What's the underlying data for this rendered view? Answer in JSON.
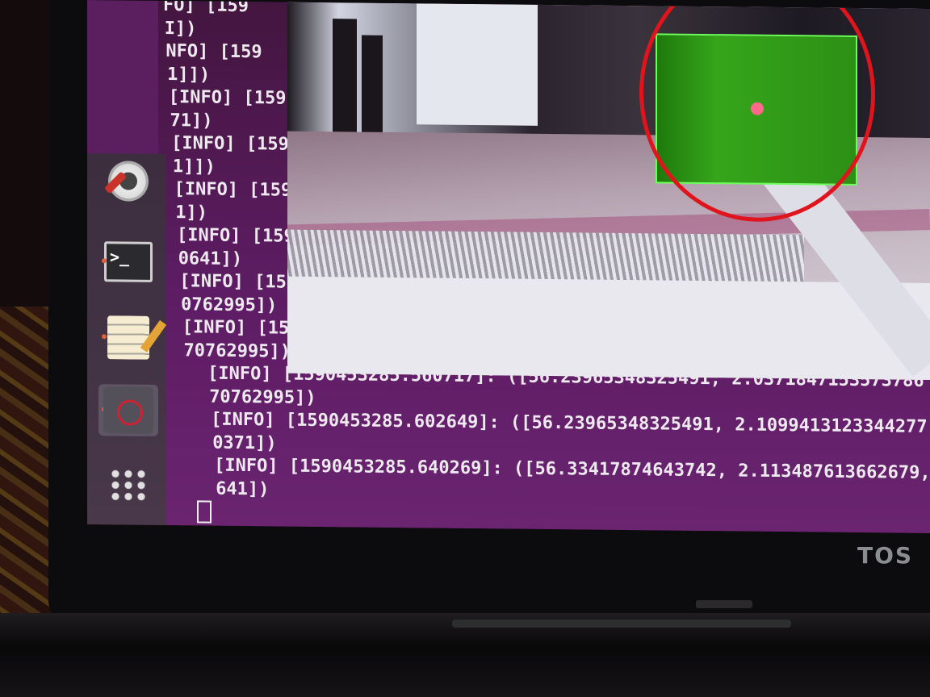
{
  "terminal": {
    "lines": [
      "FO] [159",
      "I])",
      "NFO] [159",
      "1]])",
      "[INFO] [159",
      "71])",
      "[INFO] [159",
      "1]])",
      "[INFO] [159",
      "1])",
      "[INFO] [159",
      "0641])",
      "[INFO] [159",
      "0762995])",
      "[INFO] [159",
      "70762995])",
      "[INFO] [1590453285.560717]: ([56.23965348325491, 2.0371847153573786",
      "70762995])",
      "[INFO] [1590453285.602649]: ([56.23965348325491, 2.1099413123344277,",
      "0371])",
      "[INFO] [1590453285.640269]: ([56.33417874643742, 2.113487613662679,",
      "641])"
    ]
  },
  "launcher": {
    "items": [
      {
        "name": "settings",
        "icon": "settings-gear-icon"
      },
      {
        "name": "terminal",
        "icon": "terminal-icon",
        "glyph": ">_"
      },
      {
        "name": "text-editor",
        "icon": "text-editor-icon"
      },
      {
        "name": "camera-app",
        "icon": "camera-icon"
      },
      {
        "name": "show-applications",
        "icon": "app-grid-icon"
      }
    ]
  },
  "camera_view": {
    "detected_object_color": "#36a51b",
    "contour_color": "#6cff5a",
    "centroid_color": "#ff6a8a",
    "highlight_circle_color": "#e0141c"
  },
  "laptop": {
    "brand_text": "TOS"
  }
}
